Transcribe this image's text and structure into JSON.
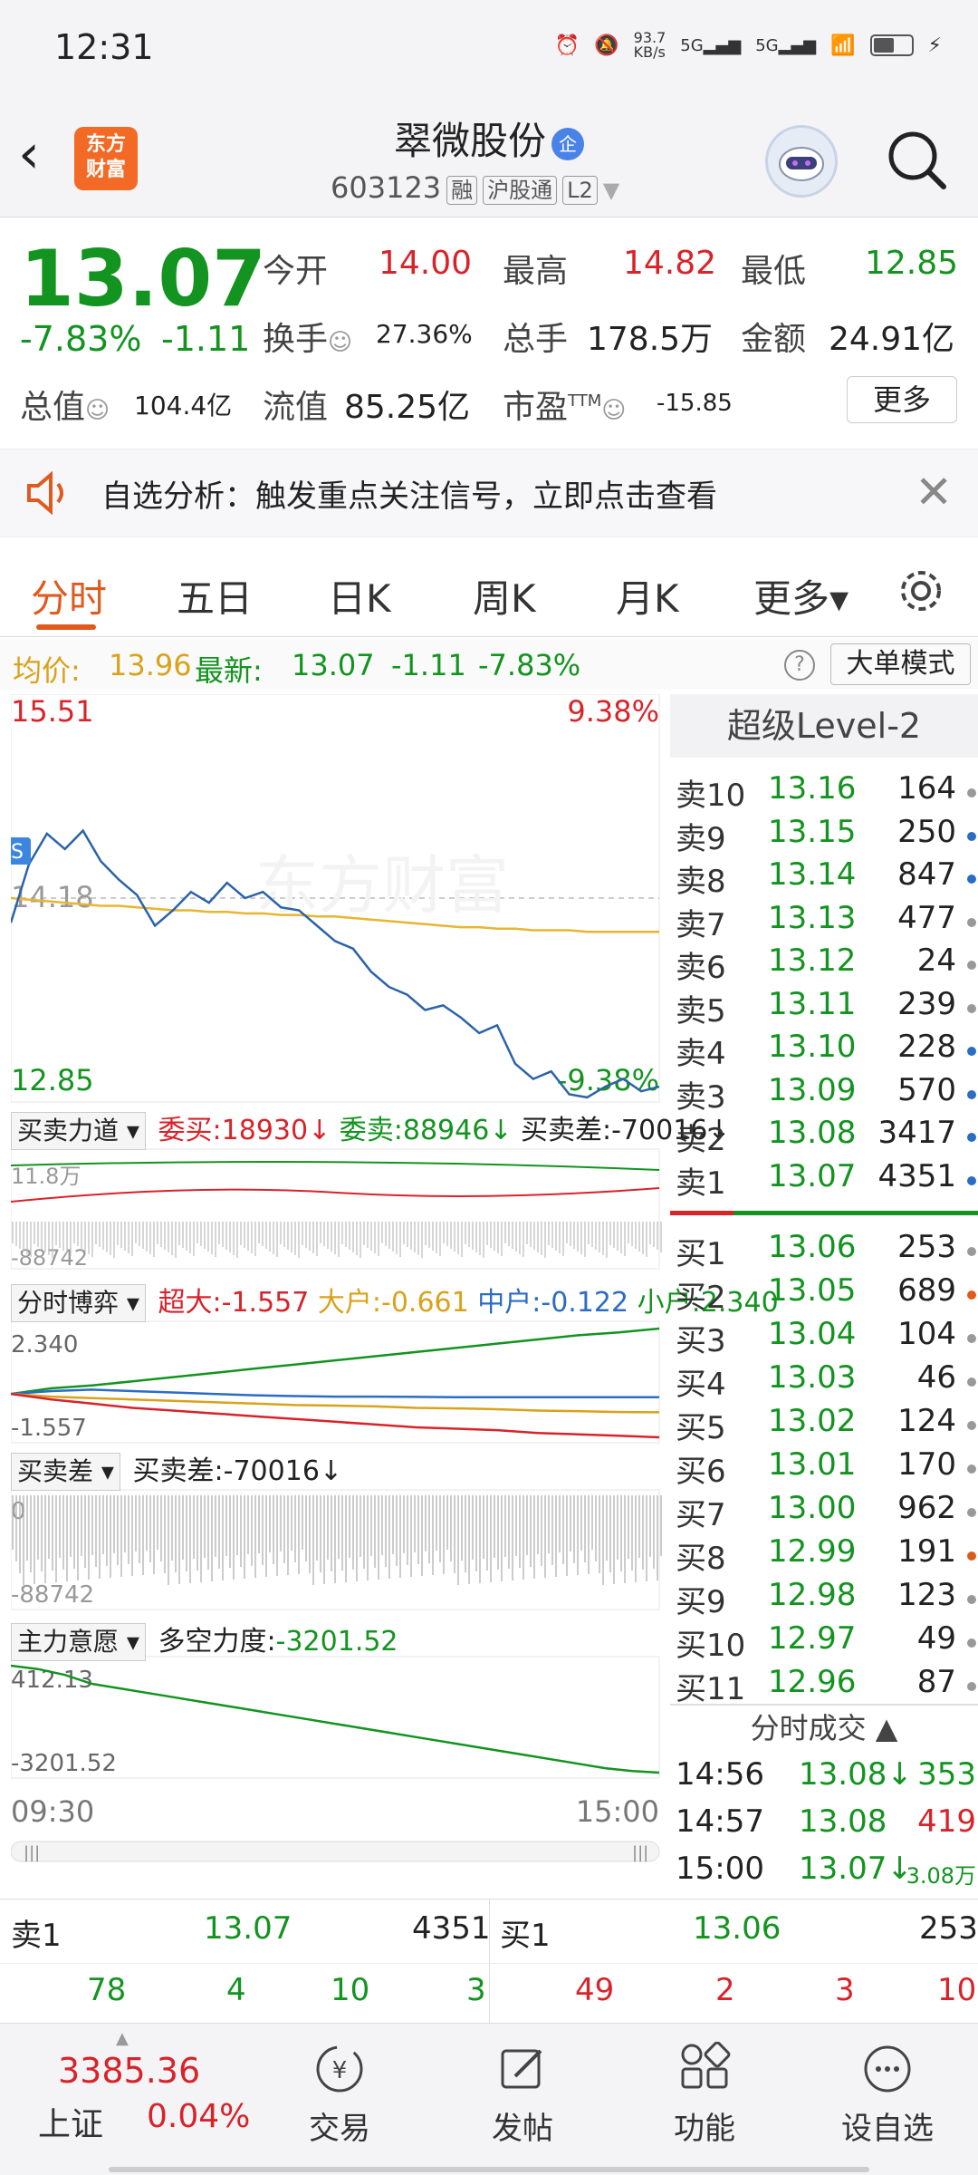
{
  "status": {
    "time": "12:31",
    "net_speed": "93.7\nKB/s",
    "battery": ""
  },
  "nav": {
    "logo_line1": "东方",
    "logo_line2": "财富",
    "stock_name": "翠微股份",
    "qi_badge": "企",
    "code": "603123",
    "tags": [
      "融",
      "沪股通",
      "L2"
    ]
  },
  "quote": {
    "price": "13.07",
    "change_pct": "-7.83%",
    "change": "-1.11",
    "open_label": "今开",
    "open": "14.00",
    "high_label": "最高",
    "high": "14.82",
    "low_label": "最低",
    "low": "12.85",
    "turnover_label": "换手",
    "turnover": "27.36%",
    "volume_label": "总手",
    "volume": "178.5万",
    "amount_label": "金额",
    "amount": "24.91亿",
    "mcap_label": "总值",
    "mcap": "104.4亿",
    "float_label": "流值",
    "float": "85.25亿",
    "pe_label": "市盈",
    "pe_sup": "TTM",
    "pe": "-15.85",
    "more": "更多"
  },
  "banner": {
    "text": "自选分析：触发重点关注信号，立即点击查看"
  },
  "tabs": [
    {
      "label": "分时"
    },
    {
      "label": "五日"
    },
    {
      "label": "日K"
    },
    {
      "label": "周K"
    },
    {
      "label": "月K"
    },
    {
      "label": "更多▾"
    }
  ],
  "avg": {
    "avg_label": "均价:",
    "avg": "13.96",
    "latest_label": "最新:",
    "latest": "13.07",
    "chg": "-1.11",
    "pct": "-7.83%",
    "help": "?",
    "big_order": "大单模式"
  },
  "chart_data": {
    "type": "line",
    "main": {
      "y_top": "15.51",
      "y_top_pct": "9.38%",
      "y_mid": "14.18",
      "y_bot": "12.85",
      "y_bot_pct": "-9.38%",
      "watermark": "东方财富",
      "badge": "S",
      "price": [
        14.02,
        14.4,
        14.6,
        14.5,
        14.62,
        14.42,
        14.3,
        14.2,
        14.0,
        14.1,
        14.22,
        14.15,
        14.28,
        14.18,
        14.22,
        14.12,
        14.1,
        14.0,
        13.9,
        13.85,
        13.7,
        13.6,
        13.55,
        13.45,
        13.48,
        13.4,
        13.3,
        13.35,
        13.1,
        13.0,
        13.05,
        12.9,
        12.88,
        12.95,
        13.0,
        12.92,
        12.95
      ],
      "avg": [
        14.18,
        14.17,
        14.16,
        14.15,
        14.14,
        14.13,
        14.13,
        14.12,
        14.11,
        14.1,
        14.1,
        14.09,
        14.09,
        14.08,
        14.08,
        14.07,
        14.07,
        14.06,
        14.06,
        14.05,
        14.04,
        14.03,
        14.02,
        14.01,
        14.0,
        13.99,
        13.99,
        13.98,
        13.98,
        13.97,
        13.97,
        13.97,
        13.96,
        13.96,
        13.96,
        13.96,
        13.96
      ],
      "ylim": [
        12.85,
        15.51
      ],
      "x_start": "09:30",
      "x_end": "15:00"
    },
    "panel1": {
      "selector": "买卖力道",
      "buy_label": "委买:",
      "buy": "18930",
      "sell_label": "委卖:",
      "sell": "88946",
      "diff_label": "买卖差:",
      "diff": "-70016",
      "top": "11.8万",
      "bottom": "-88742"
    },
    "panel2": {
      "selector": "分时博弈",
      "sup_label": "超大:",
      "sup": "-1.557",
      "big_label": "大户:",
      "big": "-0.661",
      "mid_label": "中户:",
      "mid": "-0.122",
      "small_label": "小户:",
      "small": "2.340",
      "top": "2.340",
      "bottom": "-1.557",
      "small_series": [
        0,
        0.2,
        0.3,
        0.45,
        0.6,
        0.75,
        0.9,
        1.05,
        1.2,
        1.35,
        1.5,
        1.65,
        1.8,
        1.95,
        2.1,
        2.2,
        2.34
      ],
      "mid_series": [
        0,
        0.1,
        0.15,
        0.1,
        0.05,
        0,
        -0.05,
        -0.08,
        -0.1,
        -0.1,
        -0.11,
        -0.12,
        -0.12,
        -0.12,
        -0.12,
        -0.12,
        -0.122
      ],
      "big_series": [
        0,
        -0.1,
        -0.15,
        -0.2,
        -0.25,
        -0.3,
        -0.35,
        -0.4,
        -0.42,
        -0.45,
        -0.5,
        -0.52,
        -0.55,
        -0.6,
        -0.62,
        -0.65,
        -0.661
      ],
      "sup_series": [
        0,
        -0.2,
        -0.35,
        -0.5,
        -0.6,
        -0.7,
        -0.8,
        -0.9,
        -1.0,
        -1.1,
        -1.2,
        -1.25,
        -1.3,
        -1.4,
        -1.45,
        -1.5,
        -1.557
      ]
    },
    "panel3": {
      "selector": "买卖差",
      "diff_label": "买卖差:",
      "diff": "-70016",
      "top": "0",
      "bottom": "-88742"
    },
    "panel4": {
      "selector": "主力意愿",
      "label": "多空力度:",
      "value": "-3201.52",
      "top": "412.13",
      "bottom": "-3201.52",
      "series": [
        412,
        300,
        100,
        -200,
        -350,
        -500,
        -650,
        -800,
        -950,
        -1100,
        -1250,
        -1400,
        -1550,
        -1700,
        -1850,
        -2000,
        -2150,
        -2300,
        -2450,
        -2600,
        -2750,
        -2900,
        -3050,
        -3150,
        -3201
      ]
    }
  },
  "book": {
    "header": "超级Level-2",
    "asks": [
      {
        "lbl": "卖10",
        "p": "13.16",
        "v": "164",
        "c": "#999"
      },
      {
        "lbl": "卖9",
        "p": "13.15",
        "v": "250",
        "c": "#2b6cc4"
      },
      {
        "lbl": "卖8",
        "p": "13.14",
        "v": "847",
        "c": "#2b6cc4"
      },
      {
        "lbl": "卖7",
        "p": "13.13",
        "v": "477",
        "c": "#999"
      },
      {
        "lbl": "卖6",
        "p": "13.12",
        "v": "24",
        "c": "#999"
      },
      {
        "lbl": "卖5",
        "p": "13.11",
        "v": "239",
        "c": "#999"
      },
      {
        "lbl": "卖4",
        "p": "13.10",
        "v": "228",
        "c": "#2b6cc4"
      },
      {
        "lbl": "卖3",
        "p": "13.09",
        "v": "570",
        "c": "#2b6cc4"
      },
      {
        "lbl": "卖2",
        "p": "13.08",
        "v": "3417",
        "c": "#2b6cc4"
      },
      {
        "lbl": "卖1",
        "p": "13.07",
        "v": "4351",
        "c": "#2b6cc4"
      }
    ],
    "bids": [
      {
        "lbl": "买1",
        "p": "13.06",
        "v": "253",
        "c": "#999"
      },
      {
        "lbl": "买2",
        "p": "13.05",
        "v": "689",
        "c": "#e05a1e"
      },
      {
        "lbl": "买3",
        "p": "13.04",
        "v": "104",
        "c": "#999"
      },
      {
        "lbl": "买4",
        "p": "13.03",
        "v": "46",
        "c": "#999"
      },
      {
        "lbl": "买5",
        "p": "13.02",
        "v": "124",
        "c": "#999"
      },
      {
        "lbl": "买6",
        "p": "13.01",
        "v": "170",
        "c": "#999"
      },
      {
        "lbl": "买7",
        "p": "13.00",
        "v": "962",
        "c": "#999"
      },
      {
        "lbl": "买8",
        "p": "12.99",
        "v": "191",
        "c": "#e05a1e"
      },
      {
        "lbl": "买9",
        "p": "12.98",
        "v": "123",
        "c": "#999"
      },
      {
        "lbl": "买10",
        "p": "12.97",
        "v": "49",
        "c": "#999"
      },
      {
        "lbl": "买11",
        "p": "12.96",
        "v": "87",
        "c": "#999"
      }
    ],
    "trades_header": "分时成交",
    "trades": [
      {
        "t": "14:56",
        "p": "13.08↓",
        "v": "353",
        "vc": "#13931f"
      },
      {
        "t": "14:57",
        "p": "13.08",
        "v": "419",
        "vc": "#d8232a"
      },
      {
        "t": "15:00",
        "p": "13.07↓",
        "v": "3.08万",
        "vc": "#13931f"
      }
    ]
  },
  "summary": {
    "sell1_label": "卖1",
    "sell1_price": "13.07",
    "sell1_vol": "4351",
    "buy1_label": "买1",
    "buy1_price": "13.06",
    "buy1_vol": "253",
    "sell_queue": [
      "78",
      "4",
      "10",
      "3"
    ],
    "buy_queue": [
      "49",
      "2",
      "3",
      "10"
    ]
  },
  "bottom": {
    "index_value": "3385.36",
    "index_name": "上证",
    "index_pct": "0.04%",
    "items": [
      "交易",
      "发帖",
      "功能",
      "设自选"
    ]
  }
}
